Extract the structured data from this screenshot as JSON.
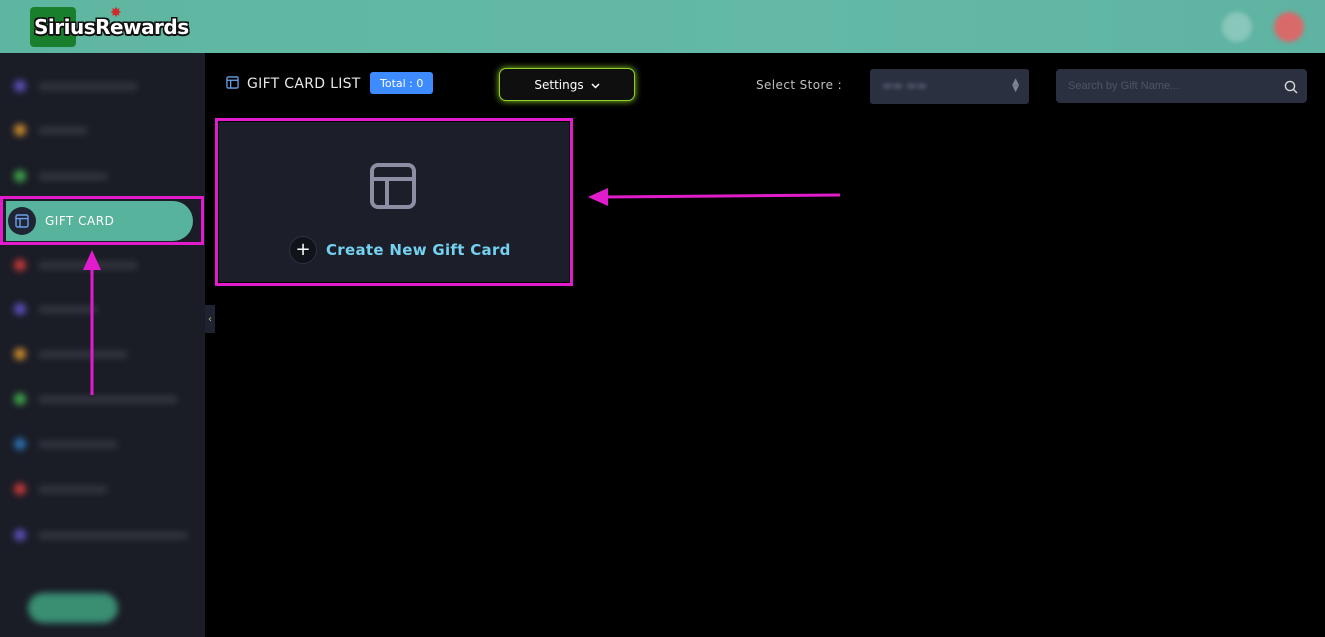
{
  "header": {
    "logo_text": "SiriusRewards"
  },
  "sidebar": {
    "active_item": {
      "label": "GIFT CARD",
      "icon": "layout-icon"
    },
    "collapse_icon": "‹"
  },
  "toolbar": {
    "title": "GIFT CARD LIST",
    "total_badge": "Total : 0",
    "settings_label": "Settings",
    "select_store_label": "Select Store :"
  },
  "search": {
    "placeholder": "Search by Gift Name..."
  },
  "card": {
    "create_label": "Create New Gift Card"
  },
  "colors": {
    "header": "#5fb6a0",
    "sidebar_active": "#57b39b",
    "highlight": "#e21ccc",
    "settings_glow": "#8fd02b",
    "badge": "#3d8bff",
    "create_text": "#74d1f0"
  }
}
